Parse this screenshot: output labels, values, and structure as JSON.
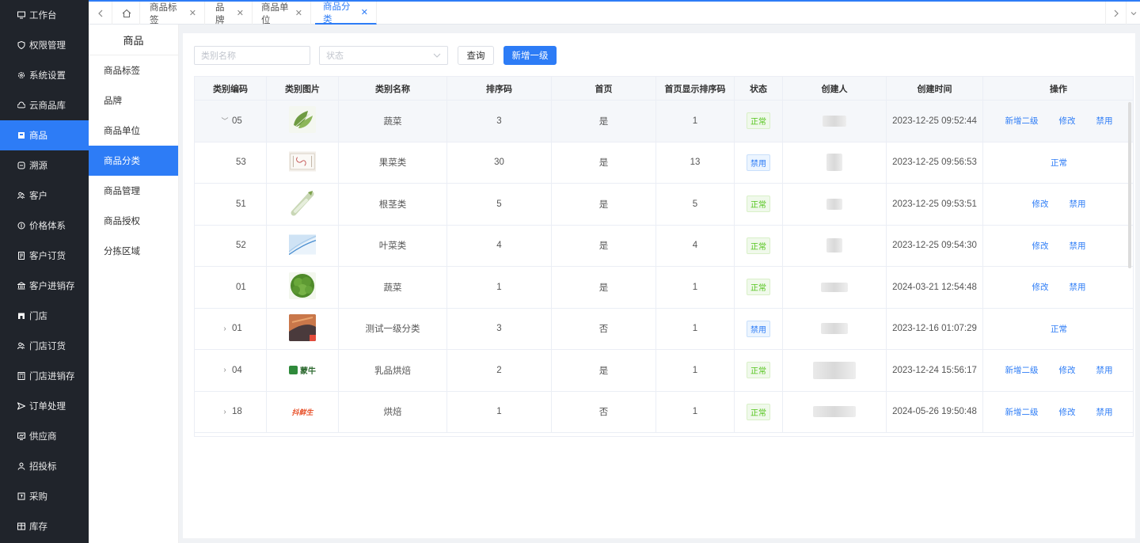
{
  "sidebar": {
    "items": [
      {
        "label": "工作台",
        "icon": "monitor-icon"
      },
      {
        "label": "权限管理",
        "icon": "shield-icon"
      },
      {
        "label": "系统设置",
        "icon": "gear-icon"
      },
      {
        "label": "云商品库",
        "icon": "cloud-icon"
      },
      {
        "label": "商品",
        "icon": "box-icon",
        "active": true
      },
      {
        "label": "溯源",
        "icon": "trace-icon"
      },
      {
        "label": "客户",
        "icon": "users-icon"
      },
      {
        "label": "价格体系",
        "icon": "price-icon"
      },
      {
        "label": "客户订货",
        "icon": "order-icon"
      },
      {
        "label": "客户进销存",
        "icon": "bank-icon"
      },
      {
        "label": "门店",
        "icon": "store-icon"
      },
      {
        "label": "门店订货",
        "icon": "users-icon"
      },
      {
        "label": "门店进销存",
        "icon": "calc-icon"
      },
      {
        "label": "订单处理",
        "icon": "send-icon"
      },
      {
        "label": "供应商",
        "icon": "supplier-icon"
      },
      {
        "label": "招投标",
        "icon": "person-icon"
      },
      {
        "label": "采购",
        "icon": "cart-icon"
      },
      {
        "label": "库存",
        "icon": "warehouse-icon"
      }
    ]
  },
  "tabs": [
    {
      "label": "商品标签",
      "active": false
    },
    {
      "label": "品牌",
      "active": false
    },
    {
      "label": "商品单位",
      "active": false
    },
    {
      "label": "商品分类",
      "active": true
    }
  ],
  "subnav": {
    "title": "商品",
    "items": [
      {
        "label": "商品标签",
        "active": false
      },
      {
        "label": "品牌",
        "active": false
      },
      {
        "label": "商品单位",
        "active": false
      },
      {
        "label": "商品分类",
        "active": true
      },
      {
        "label": "商品管理",
        "active": false
      },
      {
        "label": "商品授权",
        "active": false
      },
      {
        "label": "分拣区域",
        "active": false
      }
    ]
  },
  "filters": {
    "name_placeholder": "类别名称",
    "status_placeholder": "状态",
    "query_label": "查询",
    "add_label": "新增一级"
  },
  "table": {
    "columns": [
      "类别编码",
      "类别图片",
      "类别名称",
      "排序码",
      "首页",
      "首页显示排序码",
      "状态",
      "创建人",
      "创建时间",
      "操作"
    ],
    "rows": [
      {
        "code": "05",
        "expand": "down",
        "name": "蔬菜",
        "sort": "3",
        "home": "是",
        "home_sort": "1",
        "status": "正常",
        "status_type": "ok",
        "time": "2023-12-25 09:52:44",
        "actions": [
          "新增二级",
          "修改",
          "禁用"
        ],
        "image": "leafy-veg"
      },
      {
        "code": "53",
        "expand": "",
        "name": "果菜类",
        "sort": "30",
        "home": "是",
        "home_sort": "13",
        "status": "禁用",
        "status_type": "off",
        "time": "2023-12-25 09:56:53",
        "actions": [
          "正常"
        ],
        "image": "sketch"
      },
      {
        "code": "51",
        "expand": "",
        "name": "根茎类",
        "sort": "5",
        "home": "是",
        "home_sort": "5",
        "status": "正常",
        "status_type": "ok",
        "time": "2023-12-25 09:53:51",
        "actions": [
          "修改",
          "禁用"
        ],
        "image": "root-veg"
      },
      {
        "code": "52",
        "expand": "",
        "name": "叶菜类",
        "sort": "4",
        "home": "是",
        "home_sort": "4",
        "status": "正常",
        "status_type": "ok",
        "time": "2023-12-25 09:54:30",
        "actions": [
          "修改",
          "禁用"
        ],
        "image": "blue-wave"
      },
      {
        "code": "01",
        "expand": "",
        "name": "蔬菜",
        "sort": "1",
        "home": "是",
        "home_sort": "1",
        "status": "正常",
        "status_type": "ok",
        "time": "2024-03-21 12:54:48",
        "actions": [
          "修改",
          "禁用"
        ],
        "image": "lettuce"
      },
      {
        "code": "01",
        "expand": "right",
        "name": "测试一级分类",
        "sort": "3",
        "home": "否",
        "home_sort": "1",
        "status": "禁用",
        "status_type": "off",
        "time": "2023-12-16 01:07:29",
        "actions": [
          "正常"
        ],
        "image": "sunset"
      },
      {
        "code": "04",
        "expand": "right",
        "name": "乳品烘焙",
        "sort": "2",
        "home": "是",
        "home_sort": "1",
        "status": "正常",
        "status_type": "ok",
        "time": "2023-12-24 15:56:17",
        "actions": [
          "新增二级",
          "修改",
          "禁用"
        ],
        "image": "mengniu-logo",
        "image_text": "蒙牛"
      },
      {
        "code": "18",
        "expand": "right",
        "name": "烘焙",
        "sort": "1",
        "home": "否",
        "home_sort": "1",
        "status": "正常",
        "status_type": "ok",
        "time": "2024-05-26 19:50:48",
        "actions": [
          "新增二级",
          "修改",
          "禁用"
        ],
        "image": "brand-logo",
        "image_text": "抖鲜生"
      }
    ]
  },
  "colors": {
    "accent": "#2d7cf6",
    "sidebar_bg": "#20242b",
    "ok": "#52c41a"
  }
}
